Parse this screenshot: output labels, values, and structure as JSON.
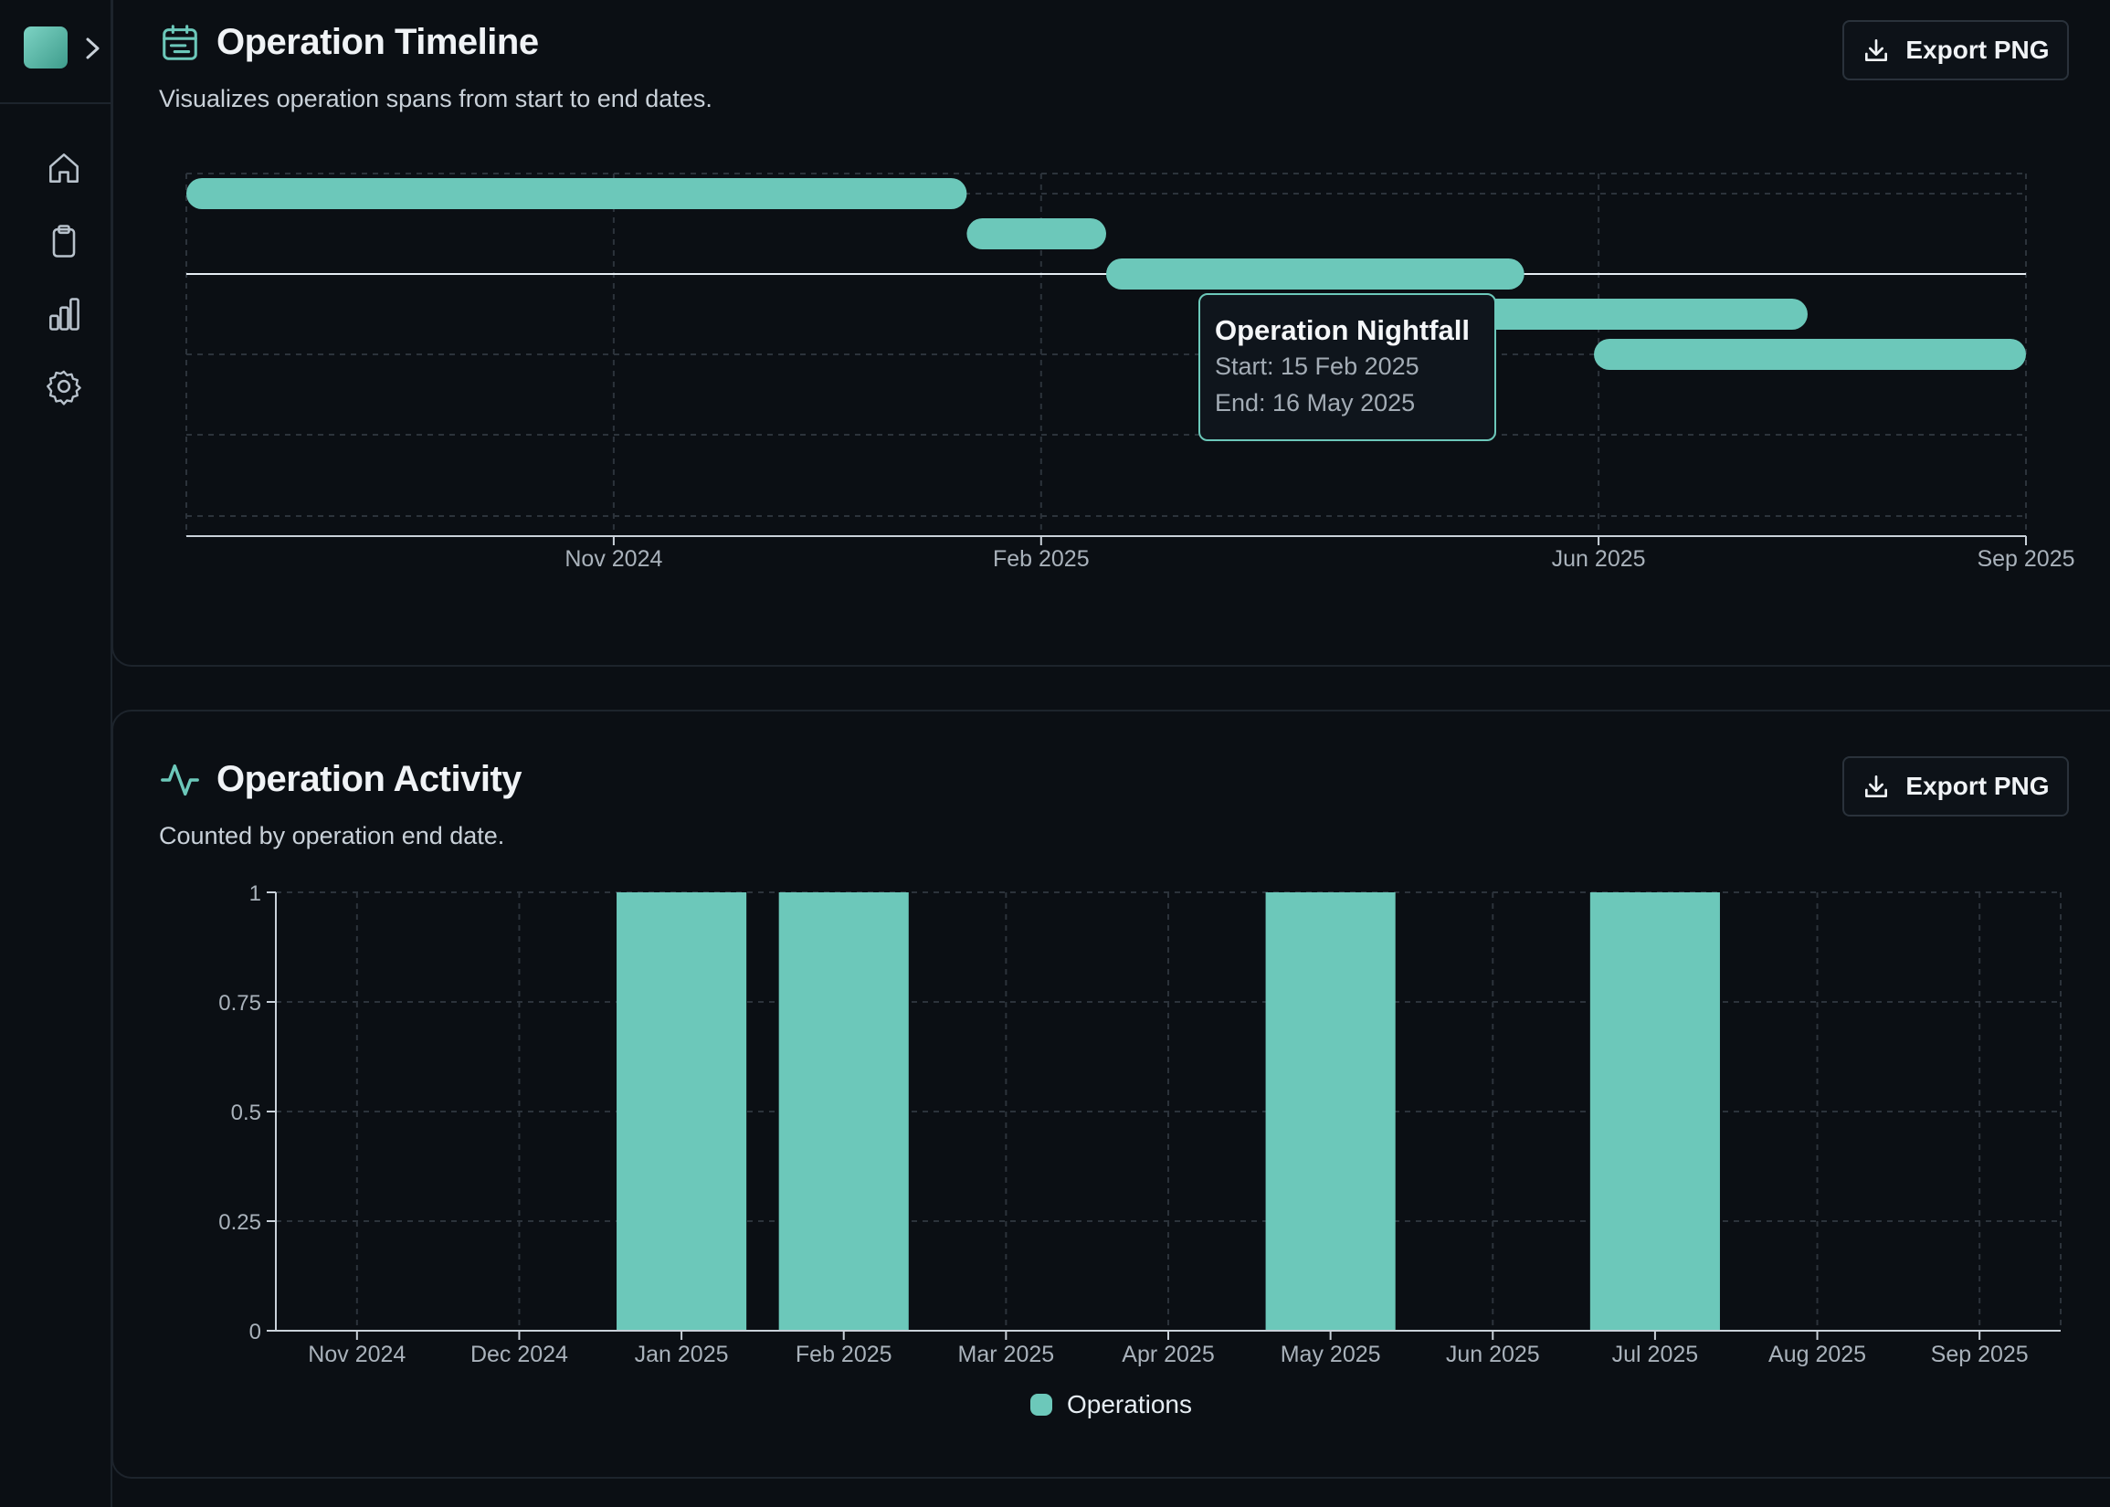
{
  "sidebar": {
    "items": [
      {
        "icon": "home-icon"
      },
      {
        "icon": "clipboard-icon"
      },
      {
        "icon": "bar-chart-icon"
      },
      {
        "icon": "gear-icon"
      }
    ]
  },
  "timeline_card": {
    "title": "Operation Timeline",
    "subtitle": "Visualizes operation spans from start to end dates.",
    "export_label": "Export PNG",
    "tooltip": {
      "title": "Operation Nightfall",
      "start": "Start: 15 Feb 2025",
      "end": "End: 16 May 2025"
    }
  },
  "activity_card": {
    "title": "Operation Activity",
    "subtitle": "Counted by operation end date.",
    "export_label": "Export PNG",
    "legend_label": "Operations"
  },
  "colors": {
    "accent": "#6cc8ba",
    "background": "#0b0f14",
    "border": "#1d242c"
  },
  "chart_data": [
    {
      "type": "bar",
      "orientation": "horizontal-range",
      "x_ticks": [
        "Nov 2024",
        "Feb 2025",
        "Jun 2025",
        "Sep 2025"
      ],
      "xlim": [
        "2024-08-01",
        "2025-09-01"
      ],
      "series": [
        {
          "start": "2024-08-01",
          "end": "2025-01-16"
        },
        {
          "start": "2025-01-16",
          "end": "2025-02-15"
        },
        {
          "start": "2025-02-15",
          "end": "2025-05-16"
        },
        {
          "start": "2025-04-01",
          "end": "2025-07-16"
        },
        {
          "start": "2025-05-31",
          "end": "2025-09-01"
        }
      ],
      "grid": true
    },
    {
      "type": "bar",
      "categories": [
        "Nov 2024",
        "Dec 2024",
        "Jan 2025",
        "Feb 2025",
        "Mar 2025",
        "Apr 2025",
        "May 2025",
        "Jun 2025",
        "Jul 2025",
        "Aug 2025",
        "Sep 2025"
      ],
      "series": [
        {
          "name": "Operations",
          "values": [
            0,
            0,
            1,
            1,
            0,
            0,
            1,
            0,
            1,
            0,
            0
          ]
        }
      ],
      "y_ticks": [
        "0",
        "0.25",
        "0.5",
        "0.75",
        "1"
      ],
      "ylim": [
        0,
        1
      ],
      "grid": true,
      "legend": "bottom-center"
    }
  ]
}
